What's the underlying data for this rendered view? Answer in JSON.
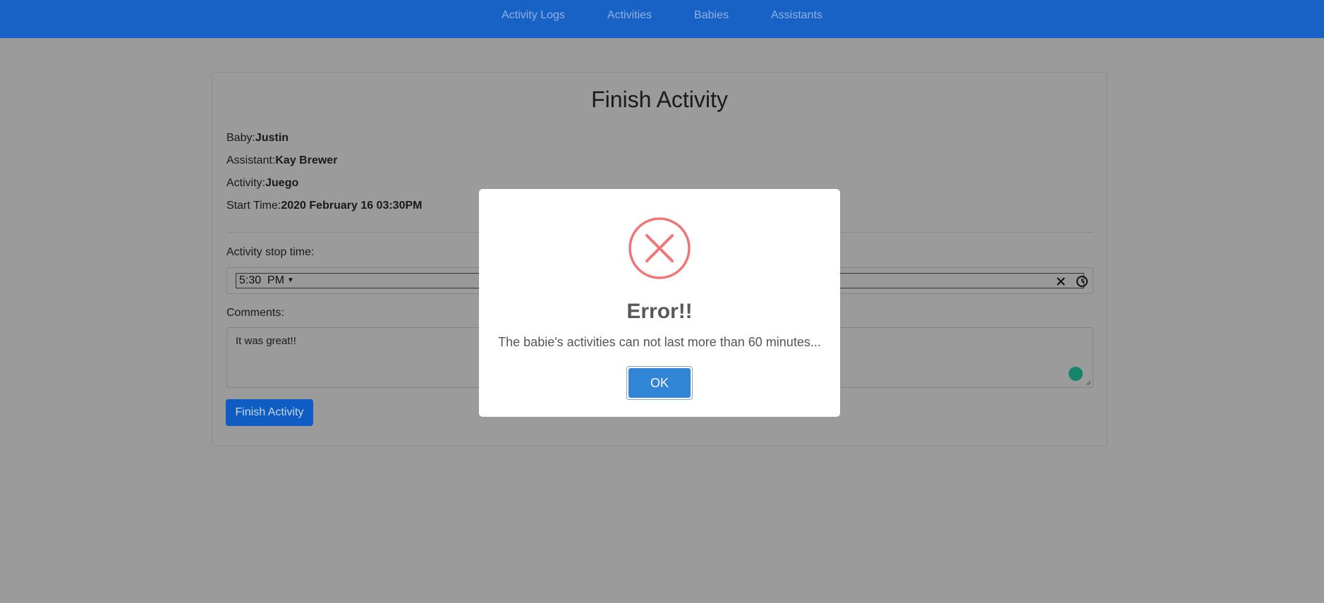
{
  "nav": {
    "items": [
      {
        "label": "Activity Logs"
      },
      {
        "label": "Activities"
      },
      {
        "label": "Babies"
      },
      {
        "label": "Assistants"
      }
    ]
  },
  "form": {
    "title": "Finish Activity",
    "baby": {
      "label": "Baby:",
      "value": "Justin"
    },
    "assistant": {
      "label": "Assistant:",
      "value": "Kay Brewer"
    },
    "activity": {
      "label": "Activity:",
      "value": "Juego"
    },
    "start_time": {
      "label": "Start Time:",
      "value": "2020 February 16 03:30PM"
    },
    "stop_time_label": "Activity stop time:",
    "stop_time_value": "5:30  PM",
    "comments_label": "Comments:",
    "comments_value": "It was great!!",
    "submit_label": "Finish Activity"
  },
  "modal": {
    "title": "Error!!",
    "message": "The babie's activities can not last more than 60 minutes...",
    "ok_label": "OK"
  },
  "colors": {
    "navbar": "#1862c6",
    "error_icon": "#f27474",
    "ok_button": "#3085d6",
    "overlay_bg": "#9b9b9b"
  },
  "icons": {
    "error": "x-circle-icon",
    "clear": "close-icon",
    "clock": "clock-icon",
    "grammarly": "grammarly-icon"
  }
}
